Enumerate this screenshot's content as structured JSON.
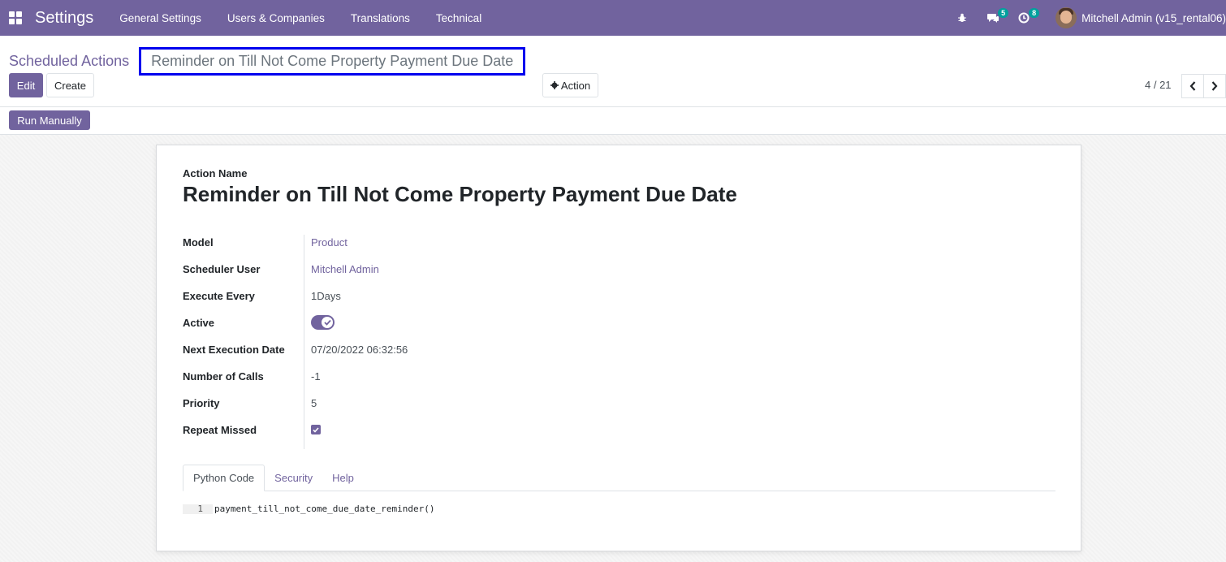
{
  "navbar": {
    "app_title": "Settings",
    "menus": [
      "General Settings",
      "Users & Companies",
      "Translations",
      "Technical"
    ],
    "chat_count": "5",
    "activity_count": "8",
    "user_name": "Mitchell Admin (v15_rental06)"
  },
  "breadcrumb": {
    "parent": "Scheduled Actions",
    "current": "Reminder on Till Not Come Property Payment Due Date"
  },
  "buttons": {
    "edit": "Edit",
    "create": "Create",
    "action": "Action",
    "run_manually": "Run Manually"
  },
  "pager": {
    "value": "4 / 21"
  },
  "form": {
    "action_name_label": "Action Name",
    "action_name": "Reminder on Till Not Come Property Payment Due Date",
    "fields": {
      "model": {
        "label": "Model",
        "value": "Product"
      },
      "scheduler_user": {
        "label": "Scheduler User",
        "value": "Mitchell Admin"
      },
      "execute_every": {
        "label": "Execute Every",
        "value": "1Days"
      },
      "active": {
        "label": "Active",
        "value": true
      },
      "next_execution_date": {
        "label": "Next Execution Date",
        "value": "07/20/2022 06:32:56"
      },
      "number_of_calls": {
        "label": "Number of Calls",
        "value": "-1"
      },
      "priority": {
        "label": "Priority",
        "value": "5"
      },
      "repeat_missed": {
        "label": "Repeat Missed",
        "value": true
      }
    },
    "tabs": [
      "Python Code",
      "Security",
      "Help"
    ],
    "active_tab": "Python Code",
    "code": {
      "line_number": "1",
      "text": "payment_till_not_come_due_date_reminder()"
    }
  },
  "colors": {
    "brand": "#71639e",
    "badge": "#00a09d",
    "highlight_box": "#0000ee"
  }
}
